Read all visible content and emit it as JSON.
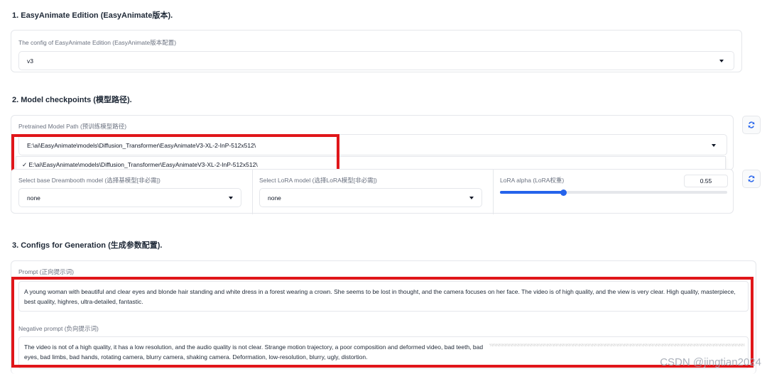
{
  "section1": {
    "title": "1. EasyAnimate Edition (EasyAnimate版本).",
    "config_label": "The config of EasyAnimate Edition (EasyAnimate版本配置)",
    "config_value": "v3"
  },
  "section2": {
    "title": "2. Model checkpoints (模型路径).",
    "pretrained_label": "Pretrained Model Path (预训练模型路径)",
    "pretrained_value": "E:\\ai\\EasyAnimate\\models\\Diffusion_Transformer\\EasyAnimateV3-XL-2-InP-512x512\\",
    "dropdown_option": "✓ E:\\ai\\EasyAnimate\\models\\Diffusion_Transformer\\EasyAnimateV3-XL-2-InP-512x512\\",
    "dreambooth_label": "Select base Dreambooth model (选择基模型[非必需])",
    "dreambooth_value": "none",
    "lora_label": "Select LoRA model (选择LoRA模型[非必需])",
    "lora_value": "none",
    "lora_alpha_label": "LoRA alpha (LoRA权重)",
    "lora_alpha_value": "0.55",
    "lora_alpha_fraction": 0.28
  },
  "section3": {
    "title": "3. Configs for Generation (生成参数配置).",
    "prompt_label": "Prompt (正向提示词)",
    "prompt_value": "A young woman with beautiful and clear eyes and blonde hair standing and white dress in a forest wearing a crown. She seems to be lost in thought, and the camera focuses on her face. The video is of high quality, and the view is very clear. High quality, masterpiece, best quality, highres, ultra-detailed, fantastic.",
    "negative_label": "Negative prompt (负向提示词)",
    "negative_value": "The video is not of a high quality, it has a low resolution, and the audio quality is not clear. Strange motion trajectory, a poor composition and deformed video, bad teeth, bad eyes, bad limbs, bad hands, rotating camera, blurry camera, shaking camera. Deformation, low-resolution, blurry, ugly, distortion."
  },
  "watermark": "CSDN @jingtian2024",
  "colors": {
    "accent": "#2563eb",
    "highlight": "#e0161a"
  },
  "icons": {
    "caret": "chevron-down-icon",
    "refresh": "refresh-icon"
  }
}
